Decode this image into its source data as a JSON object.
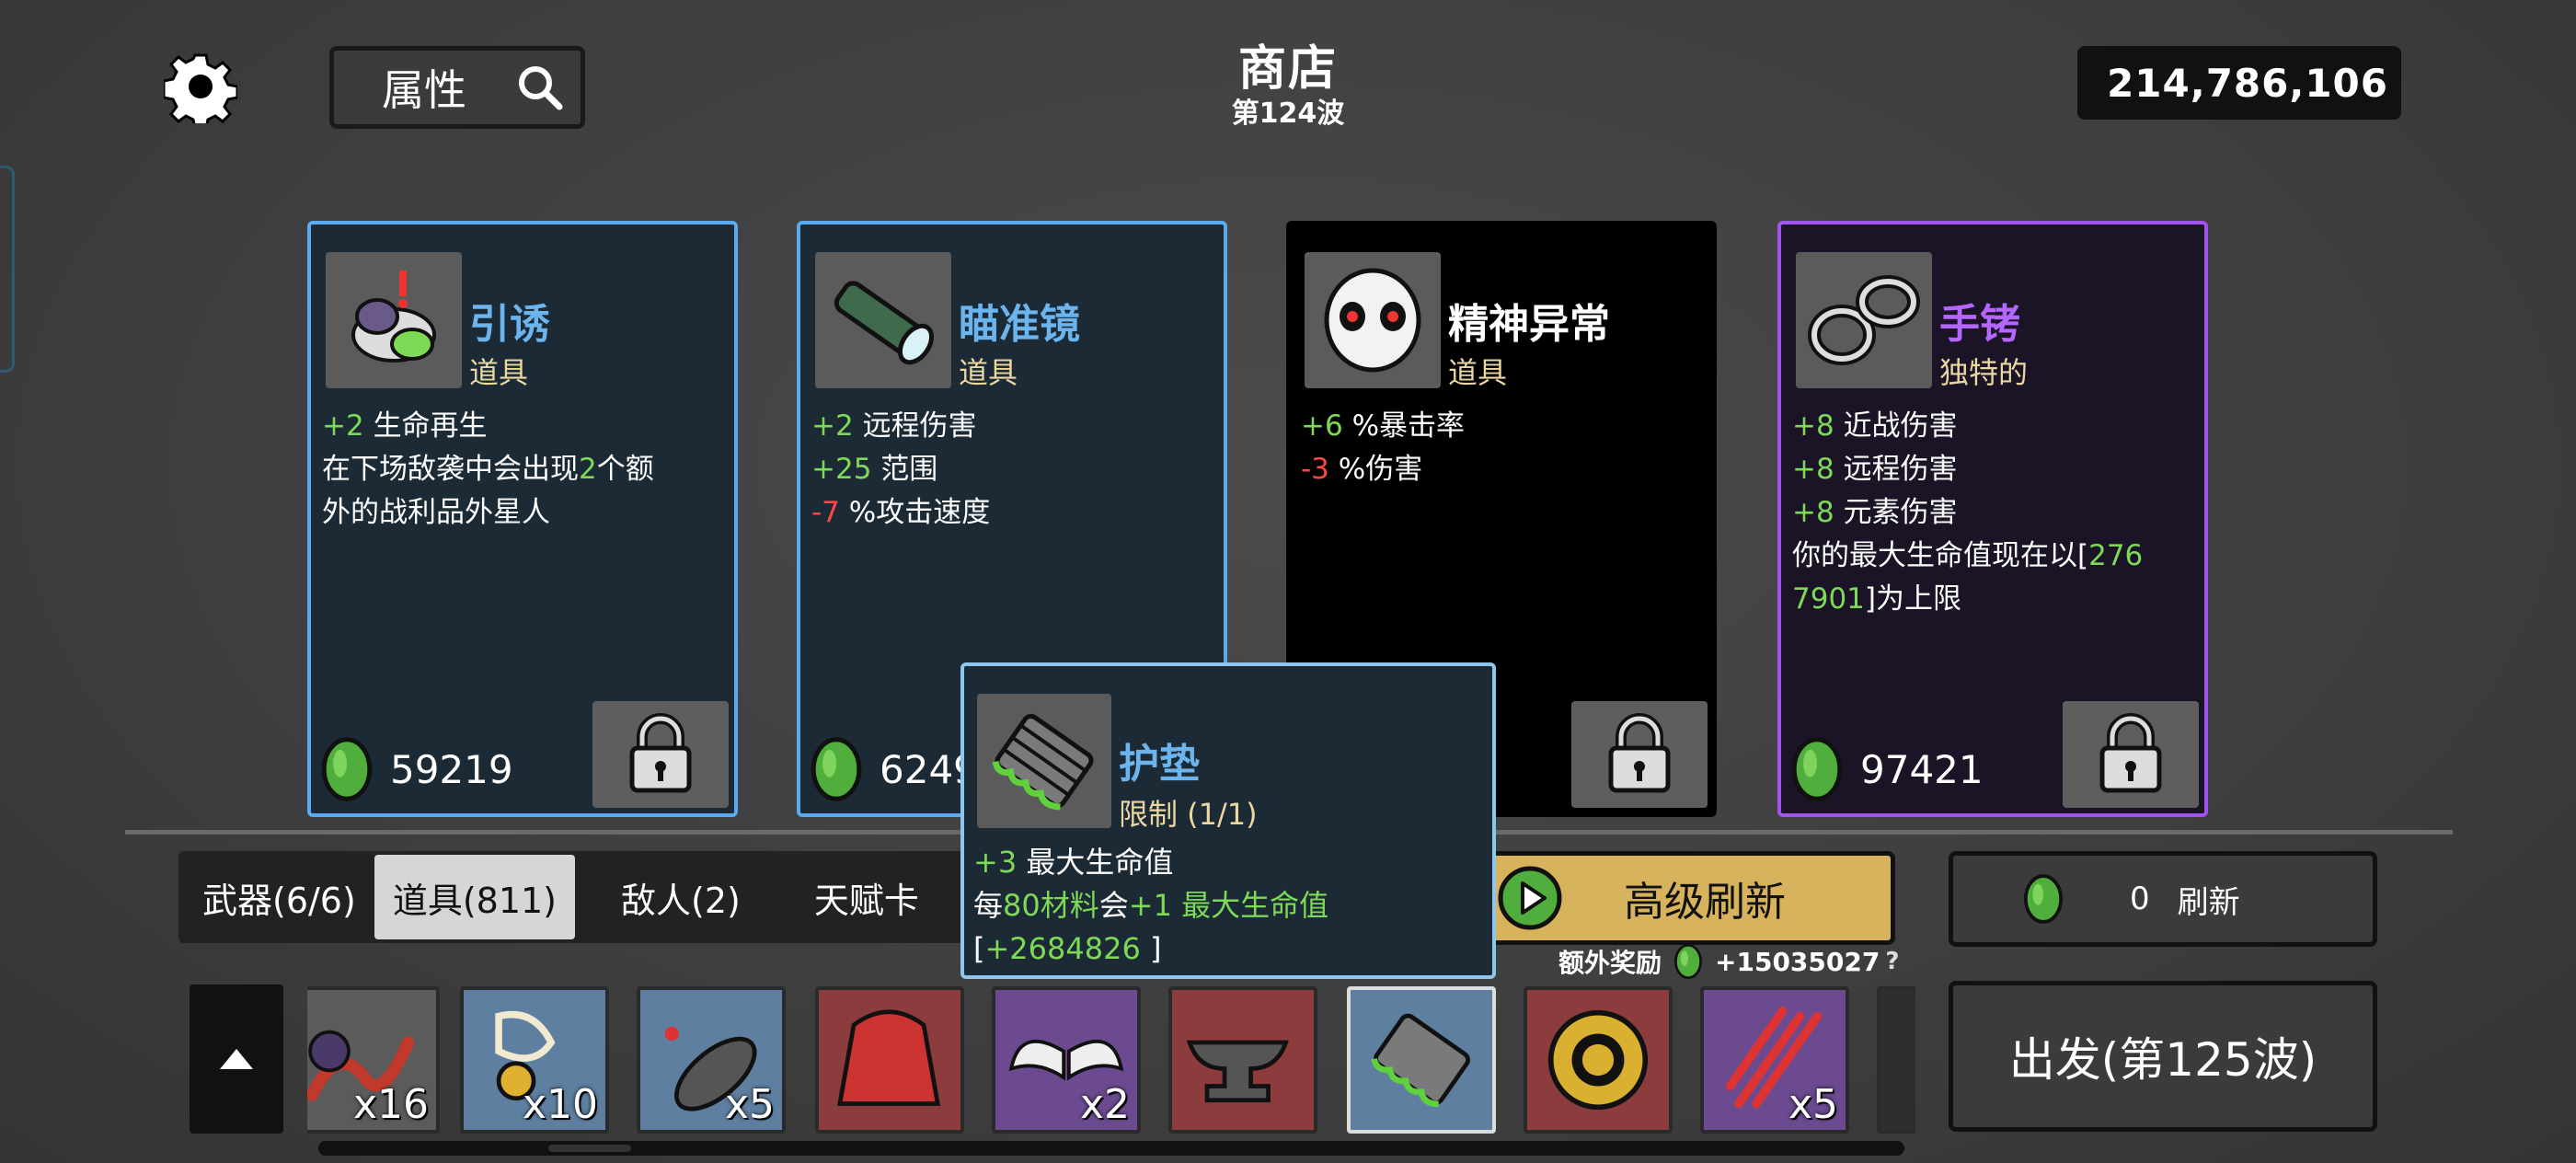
{
  "header": {
    "search_label": "属性",
    "title": "商店",
    "wave": "第124波",
    "currency": "214,786,106"
  },
  "cards": [
    {
      "name": "引诱",
      "type": "道具",
      "price": "59219",
      "rarity": "common",
      "border": "#5aaaf0",
      "bg": "#1b2a35",
      "name_color": "#6bb4ee",
      "stats": [
        [
          {
            "t": "+2 ",
            "c": "g"
          },
          {
            "t": "生命再生"
          }
        ],
        [
          {
            "t": "在下场敌袭中会出现"
          },
          {
            "t": "2",
            "c": "g"
          },
          {
            "t": "个额"
          }
        ],
        [
          {
            "t": "外的战利品外星人"
          }
        ]
      ]
    },
    {
      "name": "瞄准镜",
      "type": "道具",
      "price": "6249",
      "rarity": "common",
      "border": "#5aaaf0",
      "bg": "#1b2a35",
      "name_color": "#6bb4ee",
      "stats": [
        [
          {
            "t": "+2 ",
            "c": "g"
          },
          {
            "t": "远程伤害"
          }
        ],
        [
          {
            "t": "+25 ",
            "c": "g"
          },
          {
            "t": "范围"
          }
        ],
        [
          {
            "t": "-7 ",
            "c": "r"
          },
          {
            "t": "%攻击速度"
          }
        ]
      ]
    },
    {
      "name": "精神异常",
      "type": "道具",
      "price": "",
      "rarity": "cursed",
      "border": "#000000",
      "bg": "#000000",
      "name_color": "#ffffff",
      "stats": [
        [
          {
            "t": "+6 ",
            "c": "g"
          },
          {
            "t": "%暴击率"
          }
        ],
        [
          {
            "t": "-3 ",
            "c": "r"
          },
          {
            "t": "%伤害"
          }
        ]
      ]
    },
    {
      "name": "手铐",
      "type": "独特的",
      "price": "97421",
      "rarity": "unique",
      "border": "#a154ee",
      "bg": "#1a1426",
      "name_color": "#b566ff",
      "stats": [
        [
          {
            "t": "+8 ",
            "c": "g"
          },
          {
            "t": "近战伤害"
          }
        ],
        [
          {
            "t": "+8 ",
            "c": "g"
          },
          {
            "t": "远程伤害"
          }
        ],
        [
          {
            "t": "+8 ",
            "c": "g"
          },
          {
            "t": "元素伤害"
          }
        ],
        [
          {
            "t": "你的最大生命值现在以["
          },
          {
            "t": "276",
            "c": "g"
          }
        ],
        [
          {
            "t": "7901",
            "c": "g"
          },
          {
            "t": "]为上限"
          }
        ]
      ]
    }
  ],
  "tabs": [
    {
      "label": "武器(6/6)",
      "active": false
    },
    {
      "label": "道具(811)",
      "active": true
    },
    {
      "label": "敌人(2)",
      "active": false
    },
    {
      "label": "天赋卡",
      "active": false
    }
  ],
  "advanced_refresh": {
    "label": "高级刷新"
  },
  "bonus": {
    "label": "额外奖励",
    "value": "+15035027",
    "help": "?"
  },
  "refresh": {
    "cost": "0",
    "label": "刷新"
  },
  "go_button": {
    "label": "出发(第125波)"
  },
  "tooltip": {
    "name": "护垫",
    "type": "限制 (1/1)",
    "stats": [
      [
        {
          "t": "+3 ",
          "c": "g"
        },
        {
          "t": "最大生命值"
        }
      ],
      [
        {
          "t": "每"
        },
        {
          "t": "80材料",
          "c": "g"
        },
        {
          "t": "会"
        },
        {
          "t": "+1 最大生命值",
          "c": "g"
        }
      ],
      [
        {
          "t": "["
        },
        {
          "t": "+2684826",
          "c": "g"
        },
        {
          "t": " ]"
        }
      ]
    ]
  },
  "inventory": [
    {
      "icon": "tentacle-icon",
      "count": "x16",
      "bg": "#5b5b5b"
    },
    {
      "icon": "amulet-icon",
      "count": "x10",
      "bg": "#5e7fa0"
    },
    {
      "icon": "seed-pod-icon",
      "count": "x5",
      "bg": "#5e7fa0"
    },
    {
      "icon": "hoodie-icon",
      "count": "",
      "bg": "#8c3c3c"
    },
    {
      "icon": "wings-icon",
      "count": "x2",
      "bg": "#6b4a90"
    },
    {
      "icon": "anvil-icon",
      "count": "",
      "bg": "#8c3c3c"
    },
    {
      "icon": "padding-icon",
      "count": "",
      "bg": "#5e7fa0"
    },
    {
      "icon": "coin-icon",
      "count": "",
      "bg": "#8c3c3c"
    },
    {
      "icon": "claw-marks-icon",
      "count": "x5",
      "bg": "#6b4a90"
    }
  ]
}
